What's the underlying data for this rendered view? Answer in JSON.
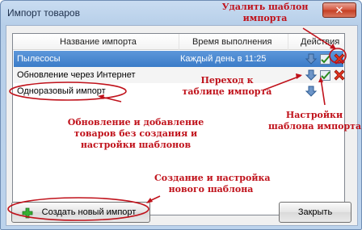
{
  "window": {
    "title": "Импорт товаров",
    "close_glyph": "✕"
  },
  "table": {
    "columns": [
      "Название импорта",
      "Время выполнения",
      "Действия"
    ],
    "rows": [
      {
        "name": "Пылесосы",
        "schedule": "Каждый день в 11:25",
        "selected": true
      },
      {
        "name": "Обновление через Интернет",
        "schedule": ""
      },
      {
        "name": "Одноразовый импорт",
        "schedule": ""
      }
    ]
  },
  "buttons": {
    "create": "Создать новый импорт",
    "close": "Закрыть"
  },
  "annotations": {
    "delete_template": [
      "Удалить шаблон",
      "импорта"
    ],
    "go_to_table": [
      "Переход к",
      "таблице импорта"
    ],
    "template_settings": [
      "Настройки",
      "шаблона импорта"
    ],
    "one_time": [
      "Обновление и добавление",
      "товаров без создания и",
      "настройки шаблонов"
    ],
    "create_new": [
      "Создание и настройка",
      "нового шаблона"
    ]
  },
  "icons": [
    "import-arrow-icon",
    "settings-check-icon",
    "delete-x-icon",
    "plus-icon",
    "close-icon"
  ],
  "colors": {
    "annotation": "#c0121b",
    "selection": "#3b7cc8"
  }
}
